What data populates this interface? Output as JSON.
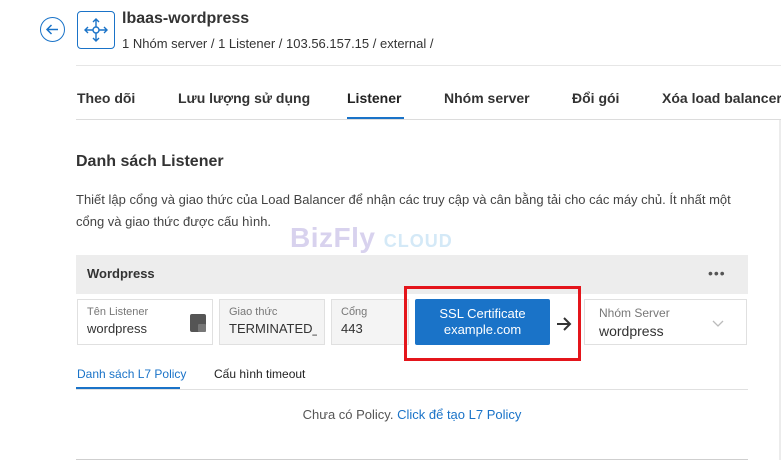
{
  "header": {
    "title": "lbaas-wordpress",
    "subtitle": "1 Nhóm server / 1 Listener / 103.56.157.15 / external /"
  },
  "tabs": [
    {
      "label": "Theo dõi"
    },
    {
      "label": "Lưu lượng sử dụng"
    },
    {
      "label": "Listener"
    },
    {
      "label": "Nhóm server"
    },
    {
      "label": "Đổi gói"
    },
    {
      "label": "Xóa load balancer"
    }
  ],
  "section": {
    "title": "Danh sách Listener",
    "description": "Thiết lập cổng và giao thức của Load Balancer để nhận các truy cập và cân bằng tải cho các máy chủ. Ít nhất một cổng và giao thức được cấu hình."
  },
  "watermark": {
    "brand": "BizFly",
    "suffix": "CLOUD"
  },
  "listener": {
    "name": "Wordpress",
    "more": "•••",
    "fields": {
      "name_label": "Tên Listener",
      "name_value": "wordpress",
      "protocol_label": "Giao thức",
      "protocol_value": "TERMINATED_HTTPS",
      "port_label": "Cổng",
      "port_value": "443",
      "ssl_line1": "SSL Certificate",
      "ssl_line2": "example.com",
      "server_group_label": "Nhóm Server",
      "server_group_value": "wordpress"
    }
  },
  "sub_tabs": [
    {
      "label": "Danh sách L7 Policy"
    },
    {
      "label": "Cấu hình timeout"
    }
  ],
  "empty_state": {
    "text": "Chưa có Policy.",
    "link": "Click để tạo L7 Policy"
  },
  "colors": {
    "accent": "#1a73c8",
    "highlight": "#e4151b"
  }
}
